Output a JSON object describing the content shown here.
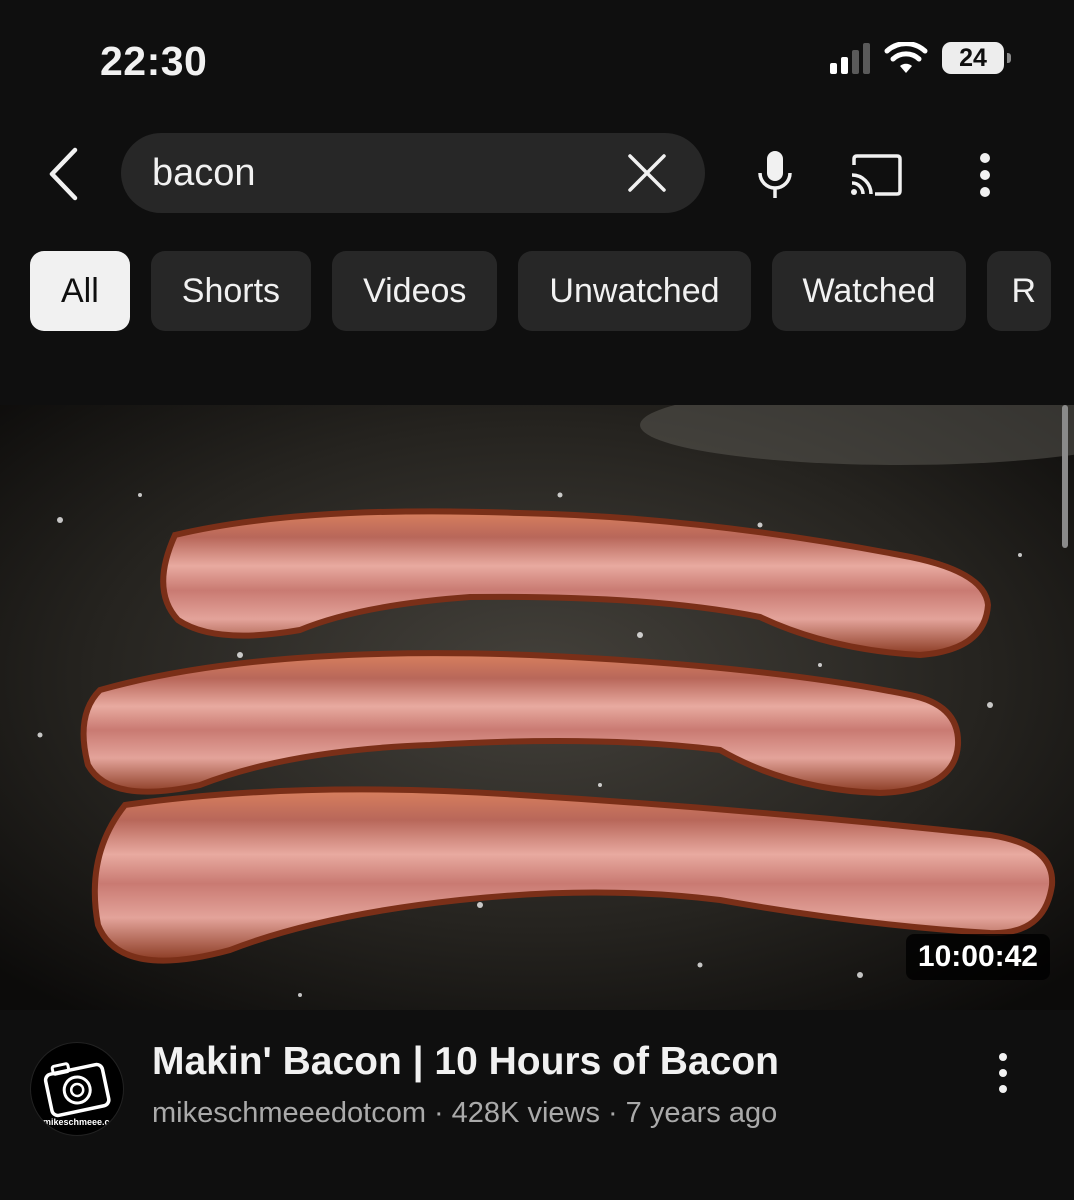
{
  "status": {
    "time": "22:30",
    "battery": "24"
  },
  "search": {
    "query": "bacon"
  },
  "chips": [
    "All",
    "Shorts",
    "Videos",
    "Unwatched",
    "Watched",
    "R"
  ],
  "active_chip": "All",
  "video": {
    "duration": "10:00:42",
    "title": "Makin' Bacon | 10 Hours of Bacon",
    "channel": "mikeschmeeedotcom",
    "views": "428K views",
    "age": "7 years ago",
    "separator": "·",
    "avatar_text": "mikeschmeee.c"
  },
  "icons": {
    "back": "chevron-left-icon",
    "clear": "close-icon",
    "voice": "microphone-icon",
    "cast": "cast-icon",
    "menu": "more-vertical-icon"
  },
  "colors": {
    "background": "#0f0f0f",
    "chip": "#272727",
    "chip_active": "#f1f1f1",
    "meta_text": "#aaaaaa"
  }
}
